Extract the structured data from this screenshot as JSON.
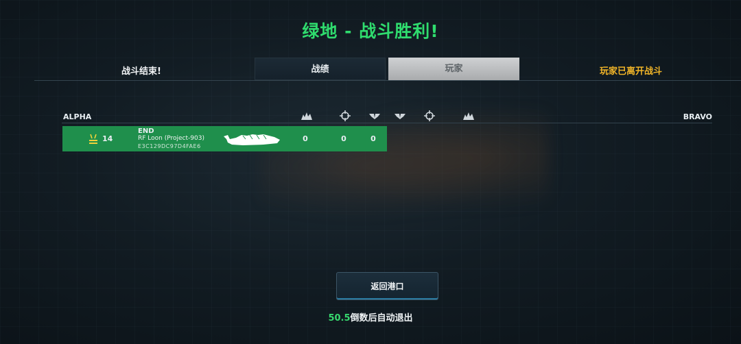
{
  "title": "绿地 - 战斗胜利!",
  "status_left": "战斗结束!",
  "tabs": [
    {
      "label": "战绩",
      "active": true
    },
    {
      "label": "玩家",
      "active": false
    }
  ],
  "status_right": "玩家已离开战斗",
  "teams": {
    "alpha": "ALPHA",
    "bravo": "BRAVO"
  },
  "column_icons": [
    "explosion-icon",
    "crosshair-icon",
    "wings-icon",
    "wings-icon",
    "crosshair-icon",
    "explosion-icon"
  ],
  "player": {
    "level": "14",
    "name": "END",
    "ship": "RF Loon (Project-903)",
    "id": "E3C129DC97D4FAE6",
    "stats": [
      "0",
      "0",
      "0"
    ]
  },
  "return_button": "返回港口",
  "countdown": {
    "value": "50.5",
    "text": "倒数后自动退出"
  },
  "colors": {
    "title": "#2fdc6e",
    "row": "#1f8f4c",
    "warning": "#f0b428"
  }
}
